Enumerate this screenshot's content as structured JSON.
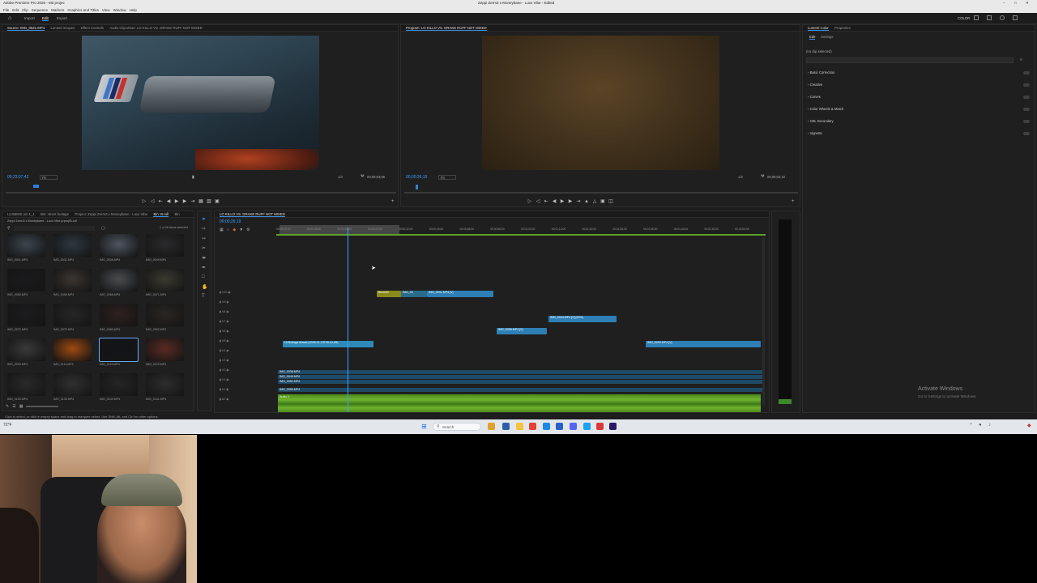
{
  "window": {
    "title_left": "Adobe Premiere Pro 2025 - M3 projec",
    "title_center": "Zeppi Zerm3 x Moneybane - Luxx Vibe - Edited",
    "menu": [
      "File",
      "Edit",
      "Clip",
      "Sequence",
      "Markers",
      "Graphics and Titles",
      "View",
      "Window",
      "Help"
    ],
    "workspace_tabs": [
      "Import",
      "Edit",
      "Export"
    ],
    "right_label": "COLOR"
  },
  "source_monitor": {
    "tabs": [
      "Source: IMG_0621.MP4",
      "Lumetri Scopes",
      "Effect Controls",
      "Audio Clip Mixer: LO KILLO VS. DRAKE RUFF NOT MIXED"
    ],
    "timecode": "00;23;07;42",
    "fit": "Fit",
    "quality": "1/4",
    "duration": "00;00;03;55"
  },
  "program_monitor": {
    "tabs": [
      "Program: LO KILLO VS. DRAKE RUFF NOT MIXED"
    ],
    "timecode": "00;00;26;19",
    "fit": "Fit",
    "quality": "1/4",
    "duration": "00;00;02;22"
  },
  "lumetri": {
    "tabs": [
      "Lumetri Color",
      "Properties"
    ],
    "subtabs": [
      "Edit",
      "Settings"
    ],
    "no_clip": "(no clip selected)",
    "sections": [
      "Basic Correction",
      "Creative",
      "Curves",
      "Color Wheels & Match",
      "HSL Secondary",
      "Vignette"
    ],
    "watermark_title": "Activate Windows",
    "watermark_sub": "Go to Settings to activate Windows."
  },
  "project_panel": {
    "tabs": [
      "LUXBINS oct 1_1",
      "Bin: street footage",
      "Project: Zeppi Zerm3 x Moneybane - Luxx Vibe",
      "Bin: B-roll",
      "Bin"
    ],
    "path": "Zeppi Zerm3 x Moneybane - Luxx Vibe.prproj\\B-roll",
    "count": "1 of 28 items selected",
    "items": [
      {
        "label": "IMG_0001.MP4",
        "color": "#3c4650"
      },
      {
        "label": "IMG_0031.MP4",
        "color": "#2e3842"
      },
      {
        "label": "IMG_0038.MP4",
        "color": "#4e5560"
      },
      {
        "label": "IMG_0049.MP4",
        "color": "#2a2a2c"
      },
      {
        "label": "IMG_0050.MP4",
        "color": "#1a1a1c"
      },
      {
        "label": "IMG_0059.MP4",
        "color": "#3a3632"
      },
      {
        "label": "IMG_0066.MP4",
        "color": "#494c4f"
      },
      {
        "label": "IMG_0071.MP4",
        "color": "#3b3a30"
      },
      {
        "label": "IMG_0072.MP4",
        "color": "#1c1c1e"
      },
      {
        "label": "IMG_0075.MP4",
        "color": "#262626"
      },
      {
        "label": "IMG_0080.MP4",
        "color": "#2f2020"
      },
      {
        "label": "IMG_0092.MP4",
        "color": "#2a2623"
      },
      {
        "label": "IMG_0093.MP4",
        "color": "#3a3a3a"
      },
      {
        "label": "IMG_0111.MP4",
        "color": "#a04a10"
      },
      {
        "label": "IMG_0115.MP4",
        "color": "#121418"
      },
      {
        "label": "IMG_0122.MP4",
        "color": "#5a2a22"
      },
      {
        "label": "IMG_0130.MP4",
        "color": "#2a2a2a"
      },
      {
        "label": "IMG_0133.MP4",
        "color": "#303030"
      },
      {
        "label": "IMG_0140.MP4",
        "color": "#252525"
      },
      {
        "label": "IMG_0141.MP4",
        "color": "#2d2d2d"
      }
    ]
  },
  "timeline": {
    "tab": "LO KILLO VS. DRAKE RUFF NOT MIXED",
    "timecode": "00;00;26;19",
    "ruler": [
      "00;00;00;00",
      "00;00;08;00",
      "00;00;16;00",
      "00;00;24;00",
      "00;00;32;00",
      "00;00;40;00",
      "00;00;48;00",
      "00;00;56;00",
      "00;01;04;00",
      "00;01;12;00",
      "00;01;20;00",
      "00;01;28;00",
      "00;01;36;00",
      "00;01;44;00",
      "00;01;52;00",
      "00;02;00;00"
    ],
    "tracks": [
      "V10",
      "V9",
      "V8",
      "V7",
      "V6",
      "V5",
      "V4",
      "V3",
      "V2",
      "V1",
      "A1",
      "A2"
    ],
    "clips": [
      {
        "label": "Bluebell",
        "color": "#8a8a1a"
      },
      {
        "label": "IMG_00",
        "color": "#2a6a8a"
      },
      {
        "label": "IMG_0031.MP4 [V]",
        "color": "#2d7fb5"
      },
      {
        "label": "IMG_0044.MP4 [V] [20%]",
        "color": "#2d7fb5"
      },
      {
        "label": "IMG_0036.MP4 [V]",
        "color": "#2d7fb5"
      },
      {
        "label": "Lit Bodega Ahead (2025-11-13T05-41-55)",
        "color": "#2d8ab8"
      },
      {
        "label": "IMG_0093.MP4 [V]",
        "color": "#2d7fb5"
      },
      {
        "label": "IMG_0038.MP4",
        "color": "#2a5f85"
      },
      {
        "label": "IMG_0049.MP4",
        "color": "#2a5f85"
      },
      {
        "label": "IMG_0052.MP4",
        "color": "#2a5f85"
      },
      {
        "label": "IMG_0055.MP4",
        "color": "#2a5f85"
      }
    ],
    "audio_label": "Audio 1"
  },
  "status_bar": "Click to select, or click in empty space and drag to marquee select. Use Shift, Alt, and Ctrl for other options.",
  "taskbar": {
    "search": "Search",
    "weather": "72°F"
  }
}
